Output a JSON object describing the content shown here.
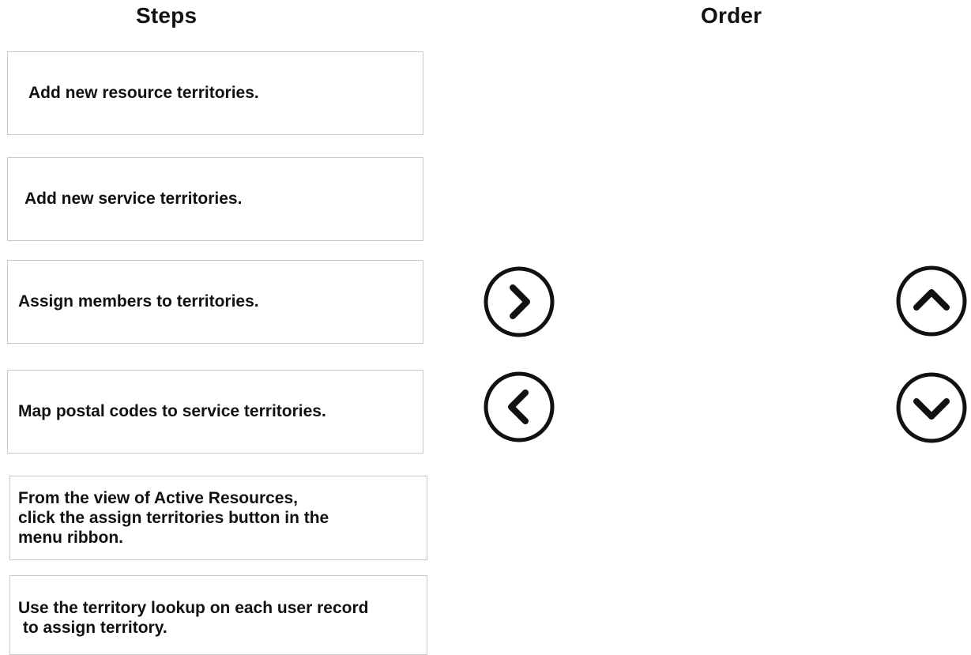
{
  "headers": {
    "steps": "Steps",
    "order": "Order"
  },
  "steps": [
    {
      "text": "Add new resource territories."
    },
    {
      "text": "Add new service territories."
    },
    {
      "text": "Assign members to territories."
    },
    {
      "text": "Map postal codes to service territories."
    },
    {
      "text": "From the view of Active Resources,\nclick the assign territories button in the\nmenu ribbon."
    },
    {
      "text": "Use the territory lookup on each user record\n to assign territory."
    }
  ],
  "controls": {
    "move_right_icon": "chevron-right-icon",
    "move_left_icon": "chevron-left-icon",
    "move_up_icon": "chevron-up-icon",
    "move_down_icon": "chevron-down-icon"
  },
  "order": []
}
